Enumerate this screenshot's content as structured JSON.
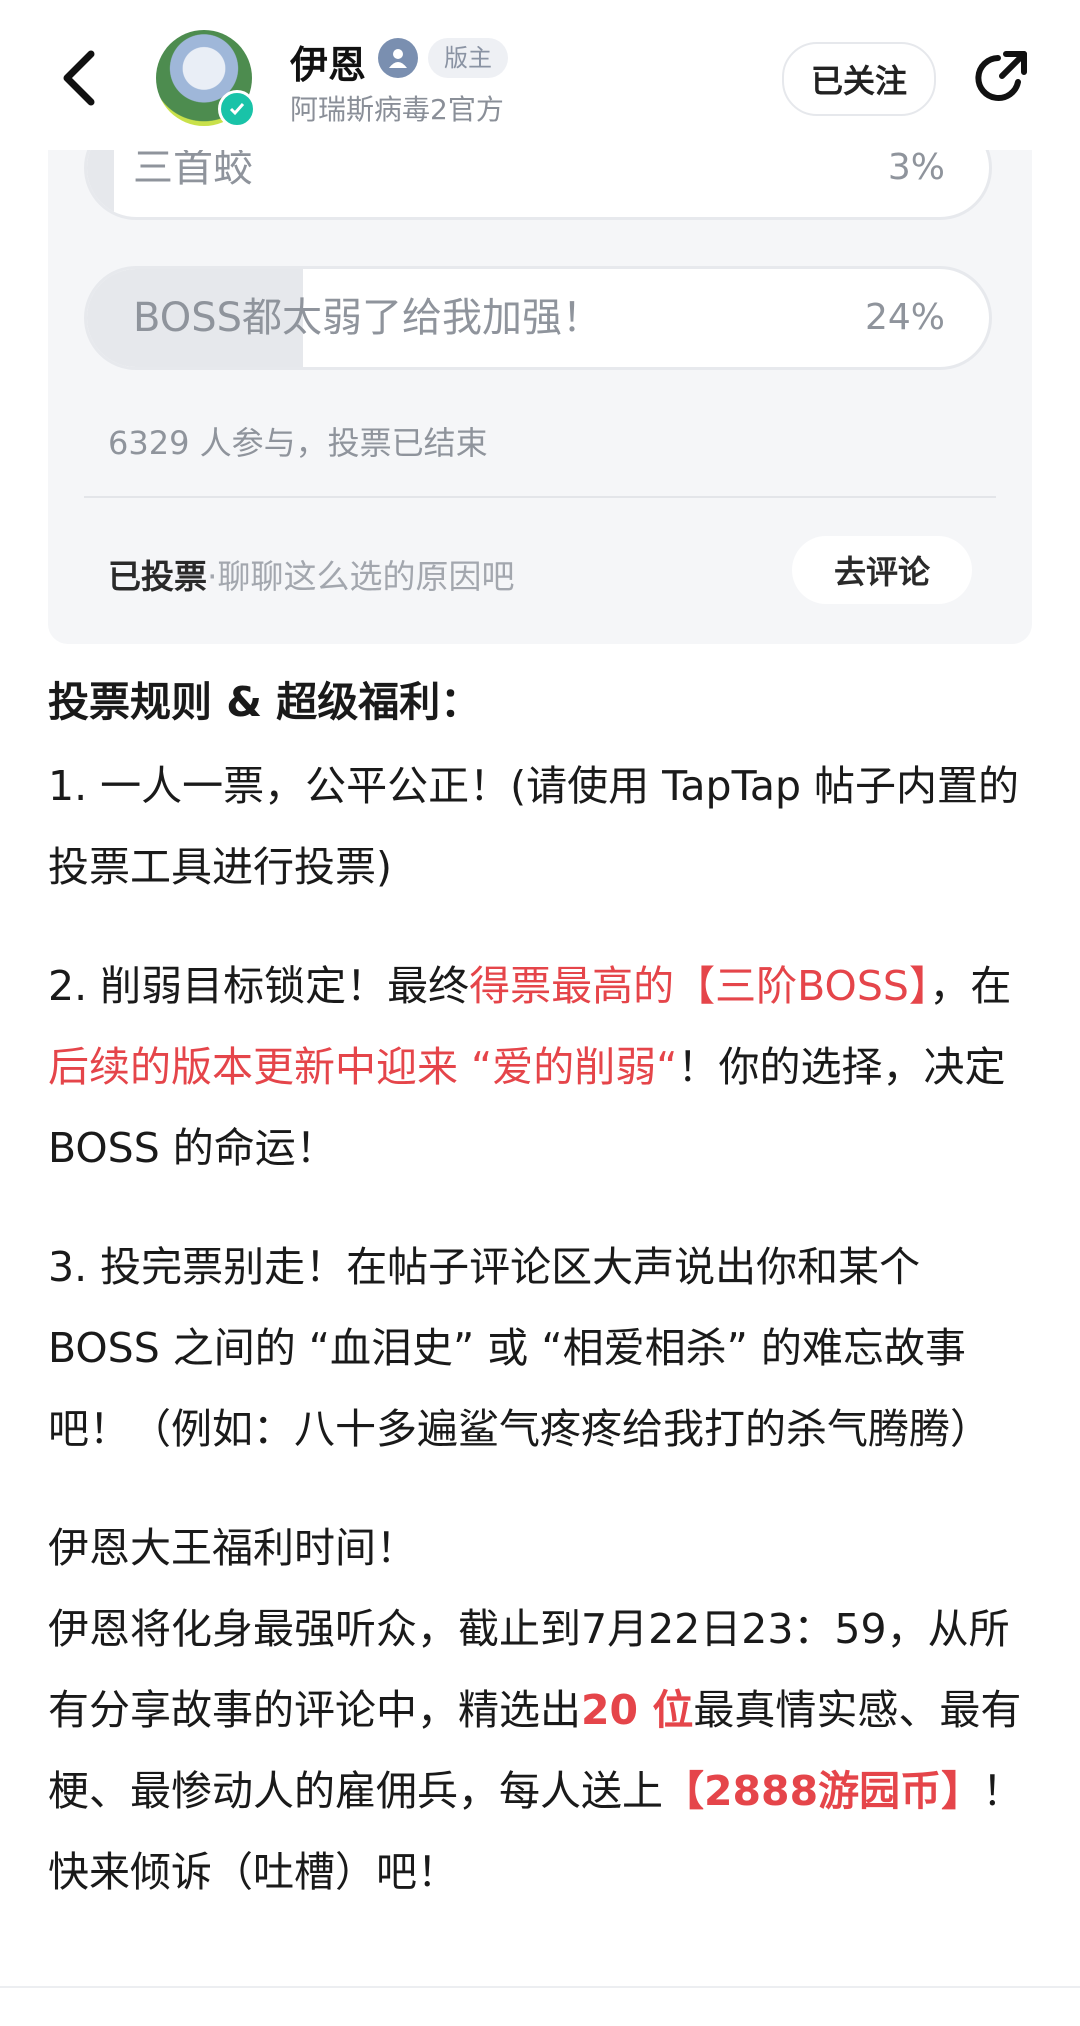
{
  "header": {
    "name": "伊恩",
    "badge": "版主",
    "subtitle": "阿瑞斯病毒2官方",
    "follow_label": "已关注",
    "icons": [
      "back-icon",
      "verified-icon",
      "admin-icon",
      "share-icon"
    ]
  },
  "poll": {
    "options": [
      {
        "label": "三首蛟",
        "percent": "3%",
        "value": 3
      },
      {
        "label": "BOSS都太弱了给我加强！",
        "percent": "24%",
        "value": 24
      }
    ],
    "summary": "6329 人参与，投票已结束",
    "voted_label": "已投票",
    "voted_separator": "·",
    "voted_hint": "聊聊这么选的原因吧",
    "comment_button": "去评论"
  },
  "article": {
    "rules_title": "投票规则 & 超级福利：",
    "rule1": " 1. 一人一票，公平公正！(请使用 TapTap 帖子内置的投票工具进行投票)",
    "rule2_a": " 2. 削弱目标锁定！最终",
    "rule2_b": "得票最高的【三阶BOSS】",
    "rule2_c": "，在",
    "rule2_d": "后续的版本更新中迎来 “爱的削弱“",
    "rule2_e": "！你的选择，决定 BOSS 的命运！",
    "rule3": "3. 投完票别走！在帖子评论区大声说出你和某个 BOSS 之间的 “血泪史” 或 “相爱相杀” 的难忘故事吧！（例如：八十多遍鲨气疼疼给我打的杀气腾腾）",
    "welfare_title": " 伊恩大王福利时间！",
    "welfare_a": "伊恩将化身最强听众，截止到7月22日23：59，从所有分享故事的评论中，精选出",
    "welfare_b": "20 位",
    "welfare_c": "最真情实感、最有梗、最惨动人的雇佣兵，每人送上",
    "welfare_d": "【2888游园币】",
    "welfare_e": "！快来倾诉（吐槽）吧！"
  },
  "colors": {
    "accent_red": "#e5454a",
    "verified": "#19c3a8",
    "card_bg": "#f5f6f8"
  }
}
